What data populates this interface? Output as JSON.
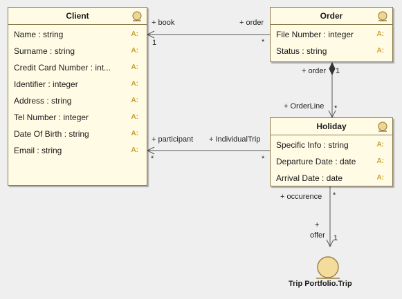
{
  "classes": {
    "client": {
      "name": "Client",
      "attributes": [
        {
          "text": "Name : string",
          "icon": "A:"
        },
        {
          "text": "Surname : string",
          "icon": "A:"
        },
        {
          "text": "Credit Card Number : int...",
          "icon": "A:"
        },
        {
          "text": "Identifier : integer",
          "icon": "A:"
        },
        {
          "text": "Address : string",
          "icon": "A:"
        },
        {
          "text": "Tel Number : integer",
          "icon": "A:"
        },
        {
          "text": "Date Of Birth : string",
          "icon": "A:"
        },
        {
          "text": "Email : string",
          "icon": "A:"
        }
      ]
    },
    "order": {
      "name": "Order",
      "attributes": [
        {
          "text": "File Number : integer",
          "icon": "A:"
        },
        {
          "text": "Status : string",
          "icon": "A:"
        }
      ]
    },
    "holiday": {
      "name": "Holiday",
      "attributes": [
        {
          "text": "Specific Info : string",
          "icon": "A:"
        },
        {
          "text": "Departure Date : date",
          "icon": "A:"
        },
        {
          "text": "Arrival Date : date",
          "icon": "A:"
        }
      ]
    }
  },
  "external": {
    "name": "Trip Portfolio.Trip"
  },
  "associations": {
    "client_order": {
      "client_role": "+ book",
      "client_mult": "1",
      "order_role": "+ order",
      "order_mult": "*"
    },
    "order_holiday": {
      "order_role": "+ order",
      "order_mult": "1",
      "holiday_role": "+ OrderLine",
      "holiday_mult": "*"
    },
    "client_holiday": {
      "client_role": "+ participant",
      "client_mult": "*",
      "holiday_role": "+ IndividualTrip",
      "holiday_mult": "*"
    },
    "holiday_trip": {
      "holiday_role": "+ occurence",
      "holiday_mult": "*",
      "trip_role_1": "+",
      "trip_role_2": "offer",
      "trip_mult": "1"
    }
  },
  "colors": {
    "class_fill": "#fffbe4",
    "class_border": "#8a7a4e",
    "attribute_icon": "#c89f2a",
    "background": "#efefef"
  },
  "icons": {
    "entity": "entity-icon",
    "attribute": "attribute-icon"
  }
}
